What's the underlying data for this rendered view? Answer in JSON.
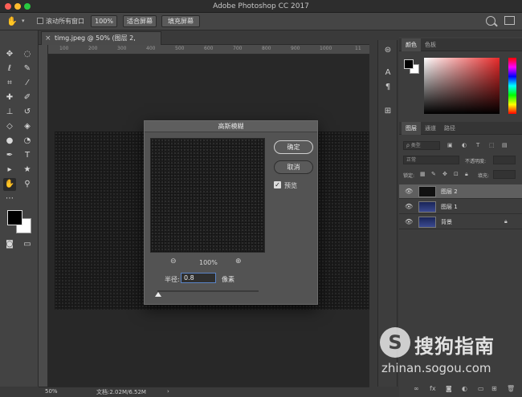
{
  "window": {
    "title": "Adobe Photoshop CC 2017"
  },
  "options_bar": {
    "scroll_all_label": "滚动所有窗口",
    "btn_100": "100%",
    "btn_fit": "适合屏幕",
    "btn_fill": "填充屏幕"
  },
  "document": {
    "tab_label": "timg.jpeg @ 50% (图层 2, RGB/8#) *",
    "close_glyph": "×"
  },
  "ruler": {
    "labels": [
      "100",
      "200",
      "300",
      "400",
      "500",
      "600",
      "700",
      "800",
      "900",
      "1000",
      "11"
    ]
  },
  "status": {
    "zoom": "50%",
    "doc_info": "文档:2.02M/6.52M",
    "arrow": "›"
  },
  "dialog": {
    "title": "高斯模糊",
    "ok_label": "确定",
    "cancel_label": "取消",
    "preview_label": "预览",
    "preview_checked": "✓",
    "zoom_percent": "100%",
    "zoom_out_glyph": "⊖",
    "zoom_in_glyph": "⊕",
    "radius_label": "半径:",
    "radius_value": "0.8",
    "radius_unit": "像素"
  },
  "color_panel": {
    "tabs": [
      "颜色",
      "色板"
    ]
  },
  "layers_panel": {
    "tabs": [
      "图层",
      "通道",
      "路径"
    ],
    "filter_kind": "ρ 类型",
    "blend_mode": "正常",
    "opacity_label": "不透明度:",
    "lock_label": "锁定:",
    "fill_label": "填充:",
    "layers": [
      {
        "name": "图层 2",
        "selected": true,
        "thumb": "#111111"
      },
      {
        "name": "图层 1",
        "selected": false,
        "thumb": "#24306a"
      },
      {
        "name": "背景",
        "selected": false,
        "thumb": "#24306a",
        "locked": true
      }
    ]
  },
  "watermark": {
    "logo_glyph": "S",
    "name": "搜狗指南",
    "url": "zhinan.sogou.com"
  }
}
